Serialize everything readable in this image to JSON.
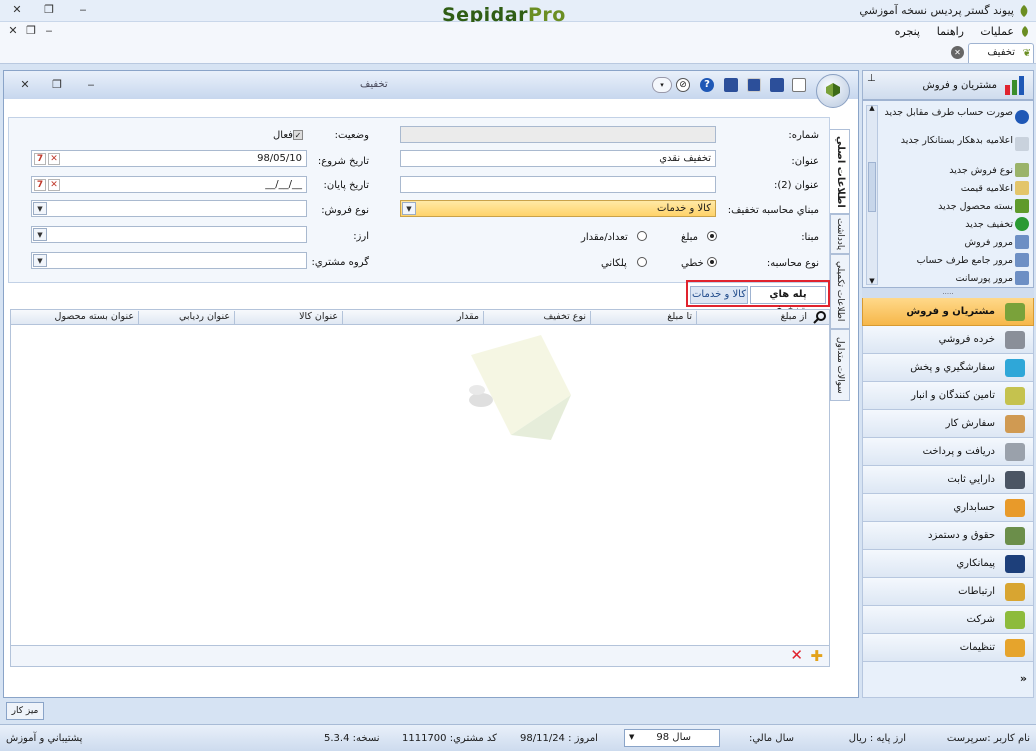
{
  "app": {
    "title": "پیوند گستر پردیس نسخه آموزشي",
    "logo_main": "Sepidar",
    "logo_suffix": "Pro"
  },
  "menu": {
    "operations": "عمليات",
    "help": "راهنما",
    "window": "پنجره"
  },
  "doc_tab": {
    "label": "تخفيف"
  },
  "window": {
    "title": "تخفيف"
  },
  "form": {
    "number_label": "شماره:",
    "number_value": "",
    "status_label": "وضعيت:",
    "active_label": "فعال",
    "active_checked": true,
    "title_label": "عنوان:",
    "title_value": "تخفيف نقدي",
    "start_date_label": "تاريخ شروع:",
    "start_date_value": "98/05/10",
    "title2_label": "عنوان (2):",
    "title2_value": "",
    "end_date_label": "تاريخ پايان:",
    "end_date_value": "__/__/__",
    "calc_base_label": "مبناي محاسبه تخفيف:",
    "calc_base_value": "کالا و خدمات",
    "sale_type_label": "نوع فروش:",
    "sale_type_value": "",
    "basis_label": "مبنا:",
    "basis_amount": "مبلغ",
    "basis_qty": "تعداد/مقدار",
    "currency_label": "ارز:",
    "currency_value": "",
    "calc_type_label": "نوع محاسبه:",
    "calc_linear": "خطي",
    "calc_stepped": "پلکاني",
    "customer_group_label": "گروه مشتري:",
    "customer_group_value": ""
  },
  "subtabs": {
    "tiers": "پله هاي تخفيف",
    "goods": "کالا و خدمات"
  },
  "grid": {
    "columns": [
      "از مبلغ",
      "تا مبلغ",
      "نوع تخفيف",
      "مقدار",
      "عنوان کالا",
      "عنوان رديابي",
      "عنوان بسته محصول"
    ]
  },
  "vtabs": [
    "اطلاعات اصلي",
    "يادداشت",
    "اطلاعات تکميلي",
    "سوالات متداول"
  ],
  "nav": {
    "header": "مشتريان و فروش",
    "links": [
      "صورت حساب طرف مقابل جديد",
      "اعلاميه بدهکار بستانکار جديد",
      "نوع فروش جديد",
      "اعلاميه قيمت",
      "بسته محصول جديد",
      "تخفيف جديد",
      "مرور فروش",
      "مرور جامع طرف حساب",
      "مرور پورسانت"
    ],
    "sections": [
      "مشتريان و فروش",
      "خرده فروشي",
      "سفارشگيري و پخش",
      "تامين کنندگان و انبار",
      "سفارش کار",
      "دريافت و پرداخت",
      "دارايي ثابت",
      "حسابداري",
      "حقوق و دستمزد",
      "پيمانکاري",
      "ارتباطات",
      "شرکت",
      "تنظيمات"
    ]
  },
  "taskbar": {
    "desk": "ميز کار"
  },
  "status": {
    "user": "نام کاربر :سرپرست",
    "base_currency": "ارز پايه :   ريال",
    "fiscal_year_label": "سال مالي:",
    "fiscal_year_value": "سال 98",
    "today": "امروز :   98/11/24",
    "customer_code": "کد مشتري:   1111700",
    "version": "نسخه:   5.3.4",
    "support": "پشتيباني و آموزش"
  },
  "colors": {
    "accent_orange": "#f6b74a",
    "highlight_red": "#e0232e",
    "yellow_field": "#ffd36a",
    "brand_green": "#6b8e23"
  }
}
